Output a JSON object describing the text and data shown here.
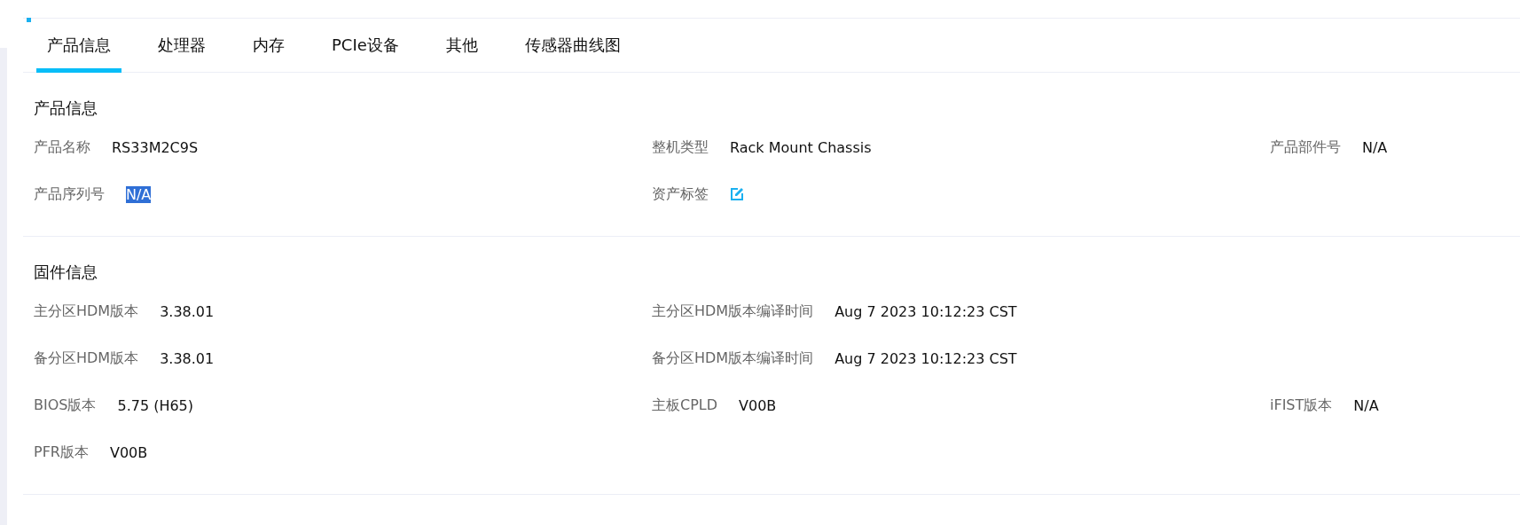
{
  "tabs": [
    {
      "label": "产品信息",
      "selected": true
    },
    {
      "label": "处理器",
      "selected": false
    },
    {
      "label": "内存",
      "selected": false
    },
    {
      "label": "PCIe设备",
      "selected": false
    },
    {
      "label": "其他",
      "selected": false
    },
    {
      "label": "传感器曲线图",
      "selected": false
    }
  ],
  "sections": [
    {
      "title": "产品信息",
      "rows": [
        [
          {
            "label": "产品名称",
            "kind": "text",
            "value": "RS33M2C9S",
            "selected": false
          },
          {
            "label": "整机类型",
            "kind": "text",
            "value": "Rack Mount Chassis",
            "selected": false
          },
          {
            "label": "产品部件号",
            "kind": "text",
            "value": "N/A",
            "selected": false
          }
        ],
        [
          {
            "label": "产品序列号",
            "kind": "text",
            "value": "N/A",
            "selected": true
          },
          {
            "label": "资产标签",
            "kind": "edit"
          }
        ]
      ]
    },
    {
      "title": "固件信息",
      "rows": [
        [
          {
            "label": "主分区HDM版本",
            "kind": "text",
            "value": "3.38.01",
            "selected": false
          },
          {
            "label": "主分区HDM版本编译时间",
            "kind": "text",
            "value": "Aug 7 2023 10:12:23 CST",
            "selected": false
          }
        ],
        [
          {
            "label": "备分区HDM版本",
            "kind": "text",
            "value": "3.38.01",
            "selected": false
          },
          {
            "label": "备分区HDM版本编译时间",
            "kind": "text",
            "value": "Aug 7 2023 10:12:23 CST",
            "selected": false
          }
        ],
        [
          {
            "label": "BIOS版本",
            "kind": "text",
            "value": "5.75 (H65)",
            "selected": false
          },
          {
            "label": "主板CPLD",
            "kind": "text",
            "value": "V00B",
            "selected": false
          },
          {
            "label": "iFIST版本",
            "kind": "text",
            "value": "N/A",
            "selected": false
          }
        ],
        [
          {
            "label": "PFR版本",
            "kind": "text",
            "value": "V00B",
            "selected": false
          }
        ]
      ]
    }
  ]
}
